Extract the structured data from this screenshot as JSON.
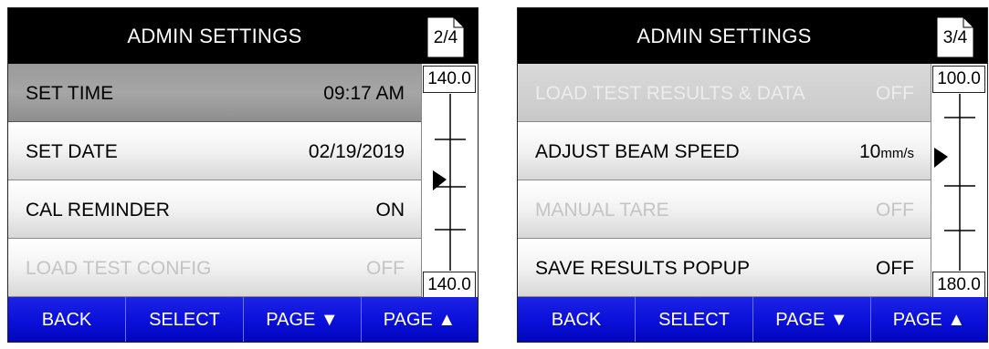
{
  "screens": [
    {
      "title": "ADMIN SETTINGS",
      "page_indicator": "2/4",
      "rows": [
        {
          "label": "SET TIME",
          "value": "09:17 AM",
          "state": "selected"
        },
        {
          "label": "SET DATE",
          "value": "02/19/2019",
          "state": "normal"
        },
        {
          "label": "CAL REMINDER",
          "value": "ON",
          "state": "normal"
        },
        {
          "label": "LOAD TEST CONFIG",
          "value": "OFF",
          "state": "disabled"
        }
      ],
      "scale": {
        "top": "140.0",
        "bottom": "140.0",
        "marker_level": 0.5
      },
      "buttons": {
        "back": "BACK",
        "select": "SELECT",
        "page_down": "PAGE ▼",
        "page_up": "PAGE ▲"
      }
    },
    {
      "title": "ADMIN SETTINGS",
      "page_indicator": "3/4",
      "rows": [
        {
          "label": "LOAD TEST RESULTS & DATA",
          "value": "OFF",
          "state": "disabled-gray"
        },
        {
          "label": "ADJUST BEAM SPEED",
          "value": "10",
          "unit": "mm/s",
          "state": "normal"
        },
        {
          "label": "MANUAL TARE",
          "value": "OFF",
          "state": "disabled"
        },
        {
          "label": "SAVE RESULTS POPUP",
          "value": "OFF",
          "state": "normal"
        }
      ],
      "scale": {
        "top": "100.0",
        "bottom": "180.0",
        "marker_level": 0.375
      },
      "buttons": {
        "back": "BACK",
        "select": "SELECT",
        "page_down": "PAGE ▼",
        "page_up": "PAGE ▲"
      }
    }
  ],
  "colors": {
    "title_bg": "#000000",
    "button_bar": "#0a0fd8",
    "selected_row": "#9e9e9e"
  }
}
